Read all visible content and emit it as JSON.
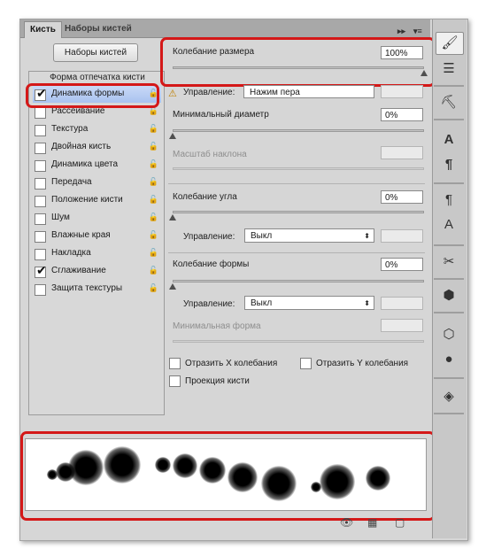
{
  "tabs": [
    "Кисть",
    "Наборы кистей"
  ],
  "panel_controls": [
    "▸▸",
    "▾≡"
  ],
  "presets_button": "Наборы кистей",
  "left_panel": {
    "header": "Форма отпечатка кисти",
    "items": [
      {
        "label": "Динамика формы",
        "checked": true,
        "active": true
      },
      {
        "label": "Рассеивание",
        "checked": false
      },
      {
        "label": "Текстура",
        "checked": false
      },
      {
        "label": "Двойная кисть",
        "checked": false
      },
      {
        "label": "Динамика цвета",
        "checked": false
      },
      {
        "label": "Передача",
        "checked": false
      },
      {
        "label": "Положение кисти",
        "checked": false
      },
      {
        "label": "Шум",
        "checked": false
      },
      {
        "label": "Влажные края",
        "checked": false
      },
      {
        "label": "Накладка",
        "checked": false
      },
      {
        "label": "Сглаживание",
        "checked": true
      },
      {
        "label": "Защита текстуры",
        "checked": false
      }
    ],
    "lock_icon": "🔓"
  },
  "settings": {
    "size_jitter": {
      "label": "Колебание размера",
      "value": "100%",
      "level": 1.0
    },
    "size_control": {
      "label": "Управление:",
      "value": "Нажим пера"
    },
    "min_diameter": {
      "label": "Минимальный диаметр",
      "value": "0%",
      "level": 0.0
    },
    "tilt_scale": {
      "label": "Масштаб наклона"
    },
    "angle_jitter": {
      "label": "Колебание угла",
      "value": "0%",
      "level": 0.0
    },
    "angle_control": {
      "label": "Управление:",
      "value": "Выкл"
    },
    "roundness_jitter": {
      "label": "Колебание формы",
      "value": "0%",
      "level": 0.0
    },
    "roundness_control": {
      "label": "Управление:",
      "value": "Выкл"
    },
    "min_roundness": {
      "label": "Минимальная форма"
    },
    "flip_x": "Отразить X колебания",
    "flip_y": "Отразить Y колебания",
    "brush_projection": "Проекция кисти"
  },
  "toolbar_icons": [
    "brush-tool-icon",
    "brush-presets-icon",
    "clone-source-icon",
    "character-icon",
    "paragraph-icon",
    "char-styles-icon",
    "para-styles-icon",
    "tools-icon",
    "3d-icon",
    "3d-scene-icon",
    "adjustments-icon",
    "layers-icon"
  ],
  "bottom_icons": [
    "toggle-live-tip-icon",
    "grid-icon",
    "new-preset-icon"
  ]
}
